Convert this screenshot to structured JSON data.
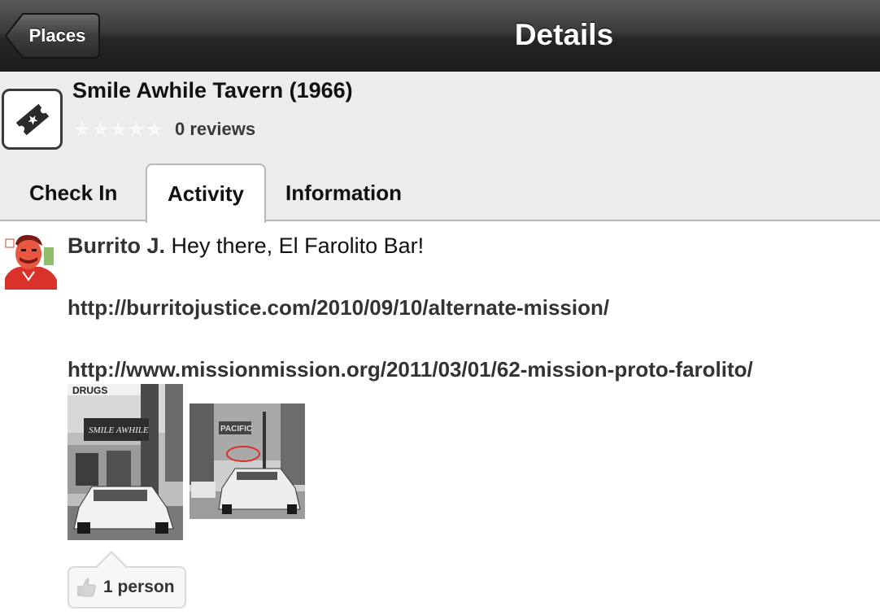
{
  "navbar": {
    "back_label": "Places",
    "title": "Details"
  },
  "venue": {
    "icon": "ticket-icon",
    "name": "Smile Awhile Tavern (1966)",
    "rating_stars": 0,
    "rating_max": 5,
    "reviews_label": "0 reviews"
  },
  "tabs": [
    {
      "label": "Check In",
      "selected": false
    },
    {
      "label": "Activity",
      "selected": true
    },
    {
      "label": "Information",
      "selected": false
    }
  ],
  "activity": {
    "author": "Burrito J.",
    "message": "Hey there, El Farolito Bar!",
    "links": [
      "http://burritojustice.com/2010/09/10/alternate-mission/",
      "http://www.missionmission.org/2011/03/01/62-mission-proto-farolito/"
    ],
    "photo_sign_texts": [
      "DRUGS",
      "SMILE AWHILE",
      "PACIFIC"
    ],
    "likes_label": "1 person",
    "like_icon": "thumbs-up-icon"
  },
  "colors": {
    "navbar_top": "#5a5a5a",
    "navbar_bottom": "#1e1e1e",
    "header_bg": "#ececec",
    "tab_border": "#b8b8b8",
    "avatar_red": "#d9322b"
  }
}
